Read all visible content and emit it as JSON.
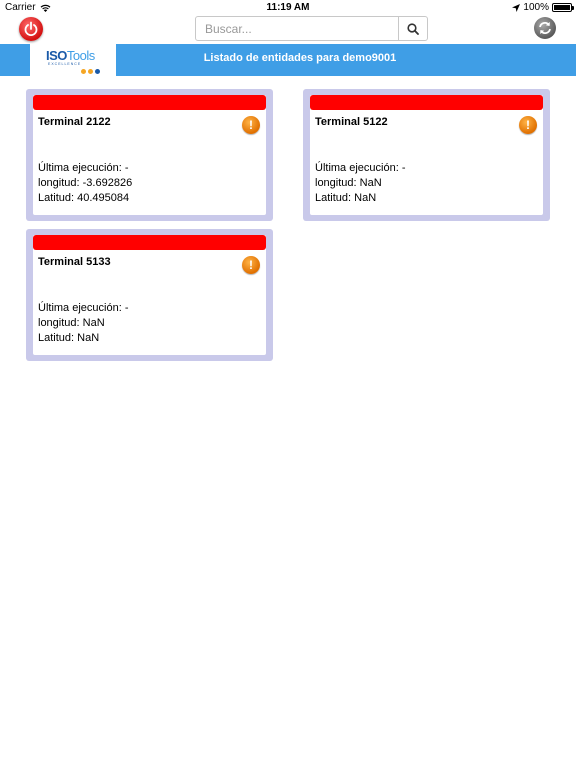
{
  "status_bar": {
    "carrier": "Carrier",
    "time": "11:19 AM",
    "battery": "100%"
  },
  "toolbar": {
    "search_placeholder": "Buscar...",
    "search_value": ""
  },
  "logo": {
    "iso": "ISO",
    "tools": "Tools",
    "sub": "EXCELLENCE",
    "dot_colors": [
      "#f5a623",
      "#f5a623",
      "#1a5aa8"
    ]
  },
  "banner": {
    "title": "Listado de entidades para demo9001"
  },
  "colors": {
    "banner": "#3f9ee6",
    "card_border": "#c9c9ea",
    "status_bar_red": "#ff0000",
    "warning": "#e07000"
  },
  "entities": [
    {
      "name": "Terminal 2122",
      "ultima_ejecucion": "Última ejecución: -",
      "longitud": "longitud: -3.692826",
      "latitud": "Latitud: 40.495084"
    },
    {
      "name": "Terminal 5122",
      "ultima_ejecucion": "Última ejecución: -",
      "longitud": "longitud: NaN",
      "latitud": "Latitud: NaN"
    },
    {
      "name": "Terminal 5133",
      "ultima_ejecucion": "Última ejecución: -",
      "longitud": "longitud: NaN",
      "latitud": "Latitud: NaN"
    }
  ]
}
